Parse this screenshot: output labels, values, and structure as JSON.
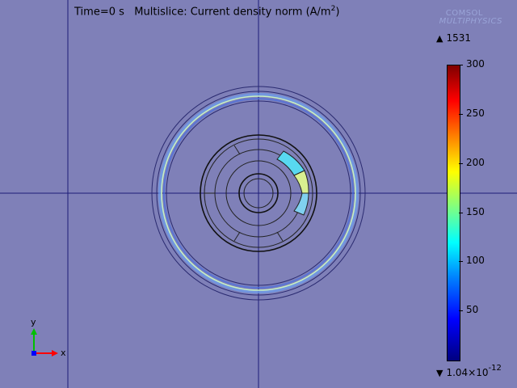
{
  "plot": {
    "time_label": "Time=0 s",
    "title_prefix": "Multislice: Current density norm (A/m",
    "title_exp": "2",
    "title_suffix": ")"
  },
  "logo": {
    "line1": "COMSOL",
    "line2": "MULTIPHYSICS"
  },
  "colorbar": {
    "max_text": "1531",
    "min_base": "1.04×10",
    "min_exp": "-12",
    "ticks": [
      "300",
      "250",
      "200",
      "150",
      "100",
      "50"
    ],
    "tick_values": [
      300,
      250,
      200,
      150,
      100,
      50
    ],
    "range": [
      0,
      300
    ]
  },
  "axes": {
    "y_label": "y",
    "x_label": "x"
  },
  "colors": {
    "background": "#7f80b8",
    "hot_segment_cyan": "#58d8f0",
    "hot_segment_yellow": "#d8f090",
    "ring_bright": "#c8f0c0",
    "ring_glow": "#70a8f0",
    "axis_x": "#ff0000",
    "axis_y": "#00c000",
    "axis_z": "#0000ff"
  }
}
